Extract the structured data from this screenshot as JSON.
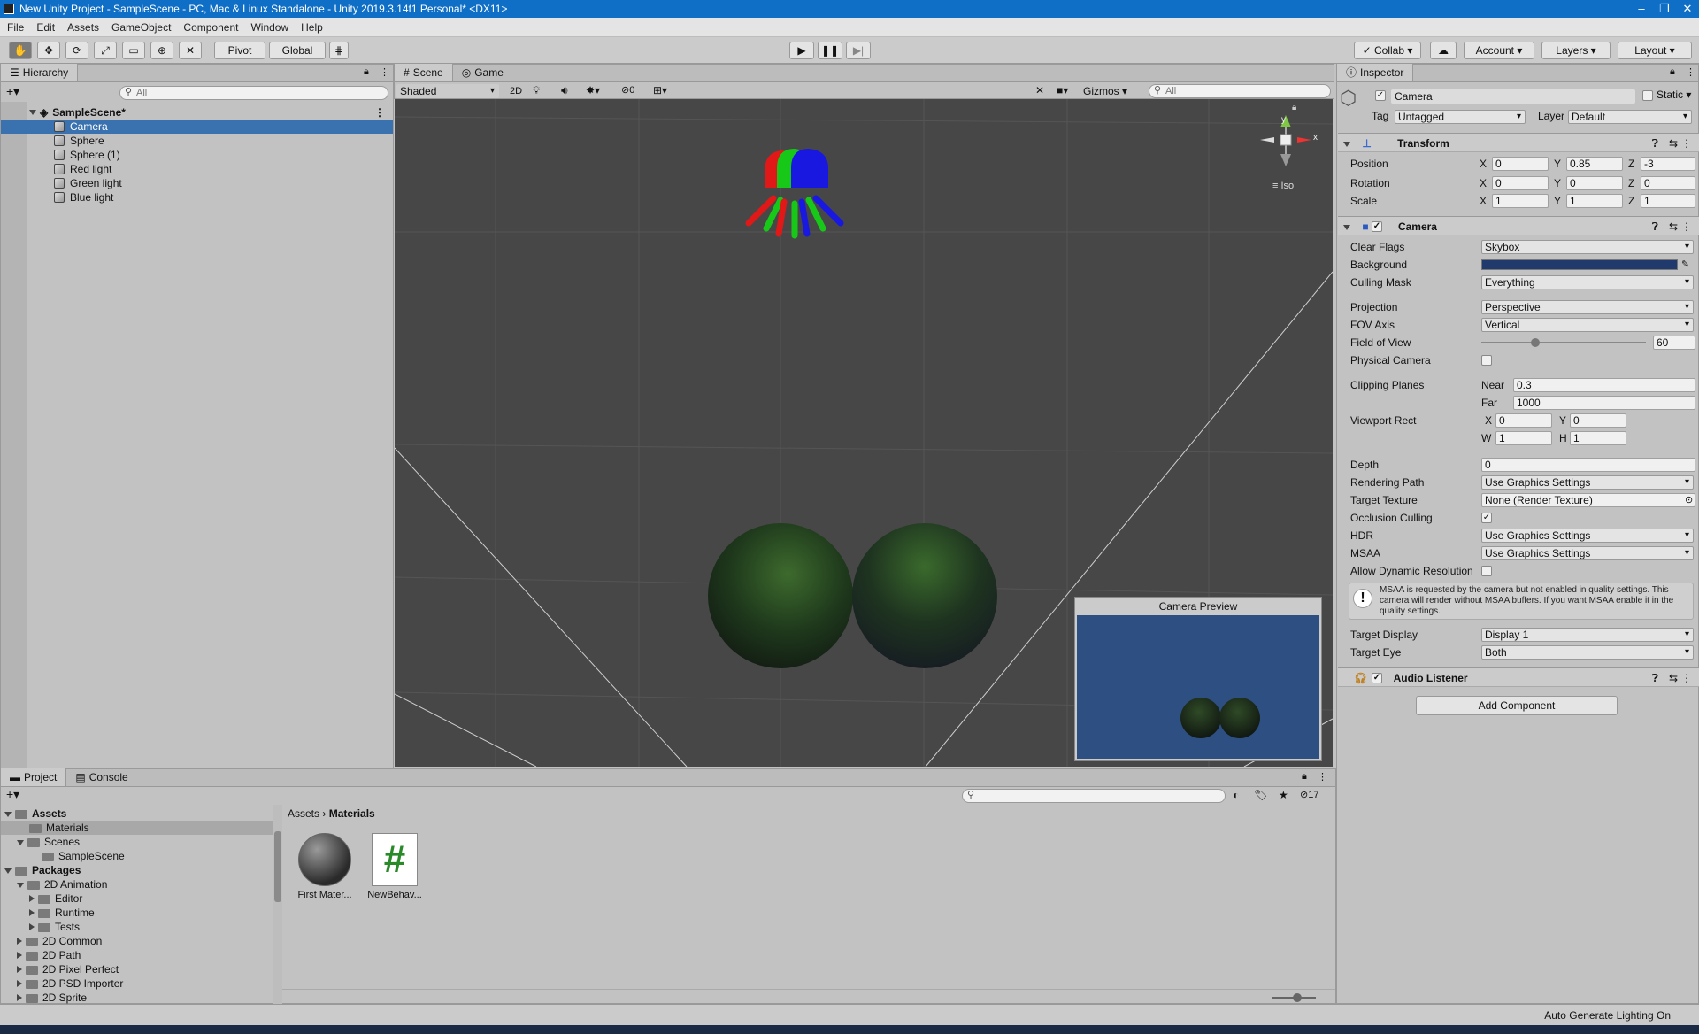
{
  "window": {
    "title": "New Unity Project - SampleScene - PC, Mac & Linux Standalone - Unity 2019.3.14f1 Personal* <DX11>"
  },
  "menu": [
    "File",
    "Edit",
    "Assets",
    "GameObject",
    "Component",
    "Window",
    "Help"
  ],
  "toolbar": {
    "pivot": "Pivot",
    "global": "Global",
    "collab": "Collab",
    "account": "Account",
    "layers": "Layers",
    "layout": "Layout"
  },
  "hierarchy": {
    "tab": "Hierarchy",
    "search_placeholder": "All",
    "scene": "SampleScene*",
    "items": [
      "Camera",
      "Sphere",
      "Sphere (1)",
      "Red light",
      "Green light",
      "Blue light"
    ]
  },
  "scene_view": {
    "tabs": [
      "Scene",
      "Game"
    ],
    "shading": "Shaded",
    "mode_2d": "2D",
    "hidden_count": "0",
    "gizmos": "Gizmos",
    "search_placeholder": "All",
    "axis_x": "x",
    "axis_y": "y",
    "iso": "Iso",
    "camera_preview_title": "Camera Preview"
  },
  "inspector": {
    "tab": "Inspector",
    "object_name": "Camera",
    "static_label": "Static",
    "tag_label": "Tag",
    "tag_value": "Untagged",
    "layer_label": "Layer",
    "layer_value": "Default",
    "transform": {
      "title": "Transform",
      "position_label": "Position",
      "position": {
        "x": "0",
        "y": "0.85",
        "z": "-3"
      },
      "rotation_label": "Rotation",
      "rotation": {
        "x": "0",
        "y": "0",
        "z": "0"
      },
      "scale_label": "Scale",
      "scale": {
        "x": "1",
        "y": "1",
        "z": "1"
      }
    },
    "camera": {
      "title": "Camera",
      "clear_flags_label": "Clear Flags",
      "clear_flags": "Skybox",
      "background_label": "Background",
      "background_color": "#203a6e",
      "culling_mask_label": "Culling Mask",
      "culling_mask": "Everything",
      "projection_label": "Projection",
      "projection": "Perspective",
      "fov_axis_label": "FOV Axis",
      "fov_axis": "Vertical",
      "fov_label": "Field of View",
      "fov": "60",
      "fov_slider_fraction": 0.33,
      "physical_camera_label": "Physical Camera",
      "clipping_label": "Clipping Planes",
      "near_label": "Near",
      "near": "0.3",
      "far_label": "Far",
      "far": "1000",
      "viewport_label": "Viewport Rect",
      "vx": "0",
      "vy": "0",
      "vw": "1",
      "vh": "1",
      "depth_label": "Depth",
      "depth": "0",
      "rendering_path_label": "Rendering Path",
      "rendering_path": "Use Graphics Settings",
      "target_texture_label": "Target Texture",
      "target_texture": "None (Render Texture)",
      "occlusion_label": "Occlusion Culling",
      "hdr_label": "HDR",
      "hdr": "Use Graphics Settings",
      "msaa_label": "MSAA",
      "msaa": "Use Graphics Settings",
      "dynamic_res_label": "Allow Dynamic Resolution",
      "msaa_warning": "MSAA is requested by the camera but not enabled in quality settings. This camera will render without MSAA buffers. If you want MSAA enable it in the quality settings.",
      "target_display_label": "Target Display",
      "target_display": "Display 1",
      "target_eye_label": "Target Eye",
      "target_eye": "Both"
    },
    "audio_listener": "Audio Listener",
    "add_component": "Add Component"
  },
  "project": {
    "tabs": [
      "Project",
      "Console"
    ],
    "hidden_count": "17",
    "breadcrumb": [
      "Assets",
      "Materials"
    ],
    "tree": [
      {
        "label": "Assets",
        "bold": true
      },
      {
        "label": "Materials"
      },
      {
        "label": "Scenes"
      },
      {
        "label": "SampleScene"
      },
      {
        "label": "Packages",
        "bold": true
      },
      {
        "label": "2D Animation"
      },
      {
        "label": "Editor"
      },
      {
        "label": "Runtime"
      },
      {
        "label": "Tests"
      },
      {
        "label": "2D Common"
      },
      {
        "label": "2D Path"
      },
      {
        "label": "2D Pixel Perfect"
      },
      {
        "label": "2D PSD Importer"
      },
      {
        "label": "2D Sprite"
      }
    ],
    "assets": [
      {
        "name": "First Mater..."
      },
      {
        "name": "NewBehav..."
      }
    ],
    "script_glyph": "#"
  },
  "status": {
    "text": "Auto Generate Lighting On"
  }
}
